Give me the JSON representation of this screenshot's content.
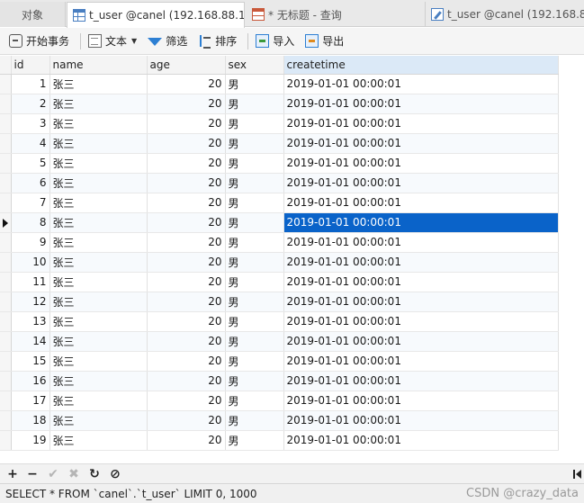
{
  "tabs": [
    {
      "label": "对象",
      "icon": "none"
    },
    {
      "label": "t_user @canel (192.168.88.1...",
      "icon": "table-icon",
      "active": true
    },
    {
      "label": "* 无标题 - 查询",
      "icon": "query-icon"
    },
    {
      "label": "t_user @canel (192.168.88.1",
      "icon": "table-edit-icon"
    }
  ],
  "toolbar": {
    "begin_transaction": "开始事务",
    "text": "文本",
    "filter": "筛选",
    "sort": "排序",
    "import": "导入",
    "export": "导出"
  },
  "grid": {
    "columns": [
      "id",
      "name",
      "age",
      "sex",
      "createtime"
    ],
    "selected_row": 8,
    "selected_column": "createtime",
    "rows": [
      [
        "1",
        "张三",
        "20",
        "男",
        "2019-01-01 00:00:01"
      ],
      [
        "2",
        "张三",
        "20",
        "男",
        "2019-01-01 00:00:01"
      ],
      [
        "3",
        "张三",
        "20",
        "男",
        "2019-01-01 00:00:01"
      ],
      [
        "4",
        "张三",
        "20",
        "男",
        "2019-01-01 00:00:01"
      ],
      [
        "5",
        "张三",
        "20",
        "男",
        "2019-01-01 00:00:01"
      ],
      [
        "6",
        "张三",
        "20",
        "男",
        "2019-01-01 00:00:01"
      ],
      [
        "7",
        "张三",
        "20",
        "男",
        "2019-01-01 00:00:01"
      ],
      [
        "8",
        "张三",
        "20",
        "男",
        "2019-01-01 00:00:01"
      ],
      [
        "9",
        "张三",
        "20",
        "男",
        "2019-01-01 00:00:01"
      ],
      [
        "10",
        "张三",
        "20",
        "男",
        "2019-01-01 00:00:01"
      ],
      [
        "11",
        "张三",
        "20",
        "男",
        "2019-01-01 00:00:01"
      ],
      [
        "12",
        "张三",
        "20",
        "男",
        "2019-01-01 00:00:01"
      ],
      [
        "13",
        "张三",
        "20",
        "男",
        "2019-01-01 00:00:01"
      ],
      [
        "14",
        "张三",
        "20",
        "男",
        "2019-01-01 00:00:01"
      ],
      [
        "15",
        "张三",
        "20",
        "男",
        "2019-01-01 00:00:01"
      ],
      [
        "16",
        "张三",
        "20",
        "男",
        "2019-01-01 00:00:01"
      ],
      [
        "17",
        "张三",
        "20",
        "男",
        "2019-01-01 00:00:01"
      ],
      [
        "18",
        "张三",
        "20",
        "男",
        "2019-01-01 00:00:01"
      ],
      [
        "19",
        "张三",
        "20",
        "男",
        "2019-01-01 00:00:01"
      ]
    ]
  },
  "nav": {
    "add": "+",
    "delete": "−",
    "apply": "✔",
    "discard": "✖",
    "refresh": "↻",
    "stop": "⊘"
  },
  "status": {
    "sql": "SELECT * FROM `canel`.`t_user` LIMIT 0, 1000",
    "watermark": "CSDN @crazy_data"
  },
  "colors": {
    "selection": "#0a63c9",
    "accent": "#2d7fd3"
  }
}
